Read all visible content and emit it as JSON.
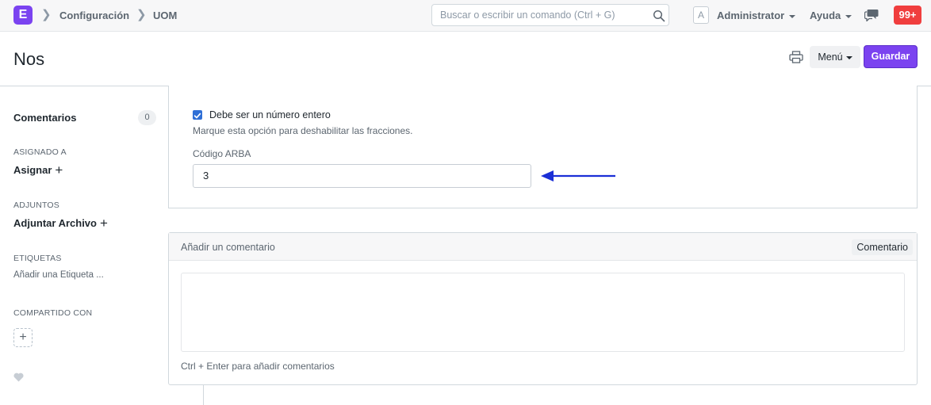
{
  "navbar": {
    "logo_letter": "E",
    "breadcrumbs": [
      "Configuración",
      "UOM"
    ],
    "search_placeholder": "Buscar o escribir un comando (Ctrl + G)",
    "avatar_letter": "A",
    "user_label": "Administrator",
    "help_label": "Ayuda",
    "notification_count": "99+"
  },
  "page": {
    "title": "Nos",
    "menu_label": "Menú",
    "save_label": "Guardar"
  },
  "sidebar": {
    "comments_label": "Comentarios",
    "comments_count": "0",
    "assigned_heading": "ASIGNADO A",
    "assign_label": "Asignar",
    "attachments_heading": "ADJUNTOS",
    "attach_label": "Adjuntar Archivo",
    "tags_heading": "ETIQUETAS",
    "add_tag_label": "Añadir una Etiqueta ...",
    "shared_heading": "COMPARTIDO CON"
  },
  "form": {
    "whole_number_label": "Debe ser un número entero",
    "whole_number_checked": true,
    "whole_number_help": "Marque esta opción para deshabilitar las fracciones.",
    "arba_label": "Código ARBA",
    "arba_value": "3"
  },
  "comments": {
    "title": "Añadir un comentario",
    "badge": "Comentario",
    "hint": "Ctrl + Enter para añadir comentarios"
  },
  "colors": {
    "brand": "#7b43f0",
    "notification": "#f03e3e",
    "checkbox": "#2f6fd6",
    "annotation_arrow": "#1b2fd6"
  },
  "icons": [
    "search-icon",
    "chat-icon",
    "print-icon",
    "heart-icon",
    "chevron-right-icon",
    "plus-icon",
    "check-icon"
  ]
}
